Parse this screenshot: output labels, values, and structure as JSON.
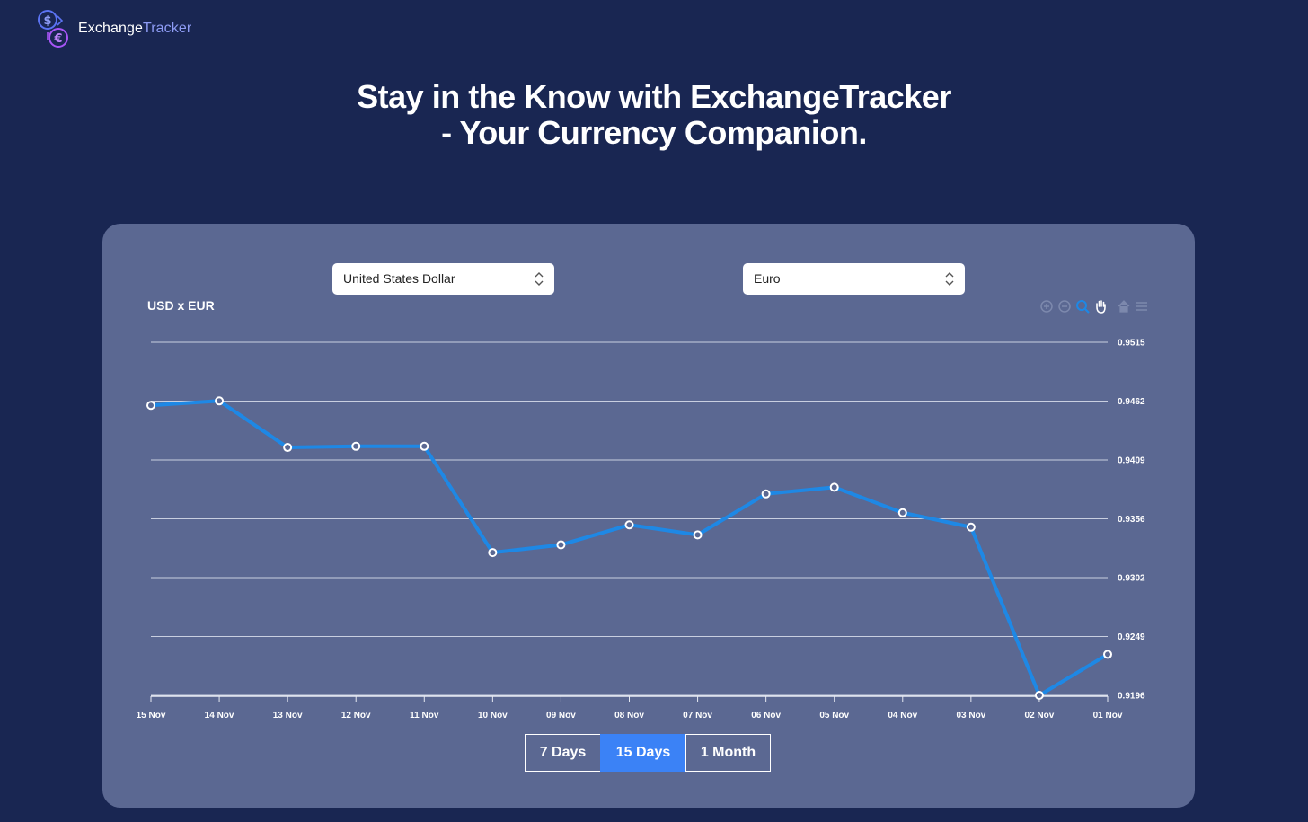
{
  "brand": {
    "name_part1": "Exchange",
    "name_part2": "Tracker",
    "logo_icon": "currency-exchange-icon"
  },
  "hero": {
    "line1": "Stay in the Know with ExchangeTracker",
    "line2": "- Your Currency Companion."
  },
  "selectors": {
    "from_currency": "United States Dollar",
    "to_currency": "Euro"
  },
  "toolbar": {
    "icons": [
      "zoom-in-icon",
      "zoom-out-icon",
      "zoom-select-icon",
      "pan-icon",
      "reset-home-icon",
      "menu-icon"
    ]
  },
  "periods": [
    {
      "label": "7 Days",
      "active": false
    },
    {
      "label": "15 Days",
      "active": true
    },
    {
      "label": "1 Month",
      "active": false
    }
  ],
  "colors": {
    "page_bg": "#192652",
    "panel_bg": "#5b6892",
    "line": "#1e88e5",
    "active": "#3b82f6"
  },
  "chart_data": {
    "type": "line",
    "title": "USD x EUR",
    "categories": [
      "15 Nov",
      "14 Nov",
      "13 Nov",
      "12 Nov",
      "11 Nov",
      "10 Nov",
      "09 Nov",
      "08 Nov",
      "07 Nov",
      "06 Nov",
      "05 Nov",
      "04 Nov",
      "03 Nov",
      "02 Nov",
      "01 Nov"
    ],
    "series": [
      {
        "values": [
          0.9458,
          0.9462,
          0.942,
          0.9421,
          0.9421,
          0.9325,
          0.9332,
          0.935,
          0.9341,
          0.9378,
          0.9384,
          0.9361,
          0.9348,
          0.9196,
          0.9233
        ]
      }
    ],
    "yticks": [
      "0.9515",
      "0.9462",
      "0.9409",
      "0.9356",
      "0.9302",
      "0.9249",
      "0.9196"
    ],
    "ylim": [
      0.9196,
      0.9515
    ],
    "y_axis_side": "right",
    "grid": true
  }
}
